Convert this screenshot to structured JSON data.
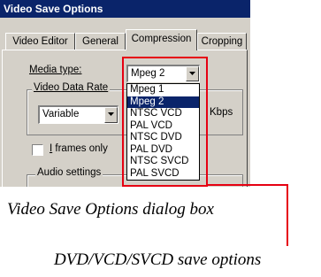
{
  "dialog": {
    "title": "Video Save Options",
    "tabs": [
      {
        "label": "Video Editor"
      },
      {
        "label": "General"
      },
      {
        "label": "Compression"
      },
      {
        "label": "Cropping"
      }
    ],
    "active_tab": "Compression",
    "media_type_label": "Media type:",
    "media_type_value": "Mpeg 2",
    "video_data_rate_legend": "Video Data Rate",
    "data_rate_mode_value": "Variable",
    "kbps_label": "Kbps",
    "i_frames_only_label": "I frames only",
    "i_frames_only_checked": false,
    "audio_settings_legend": "Audio settings",
    "media_type_options": [
      {
        "label": "Mpeg 1"
      },
      {
        "label": "Mpeg 2"
      },
      {
        "label": "NTSC VCD"
      },
      {
        "label": "PAL VCD"
      },
      {
        "label": "NTSC DVD"
      },
      {
        "label": "PAL DVD"
      },
      {
        "label": "NTSC SVCD"
      },
      {
        "label": "PAL SVCD"
      }
    ],
    "selected_option": "Mpeg 2"
  },
  "captions": {
    "dialog_caption": "Video Save Options dialog box",
    "callout_caption": "DVD/VCD/SVCD save options"
  },
  "colors": {
    "titlebar": "#0a246a",
    "dialog_face": "#d4d0c8",
    "highlight": "#0a246a",
    "callout": "#e60012"
  }
}
